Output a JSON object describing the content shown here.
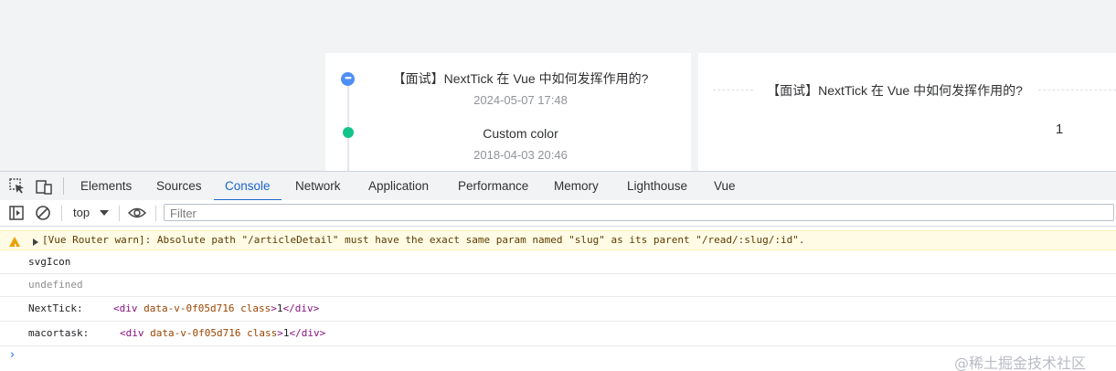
{
  "app": {
    "timeline": [
      {
        "title": "【面试】NextTick 在 Vue 中如何发挥作用的?",
        "timestamp": "2024-05-07 17:48",
        "dot_color": "#4e8ff5",
        "dot_icon": "more-icon"
      },
      {
        "title": "Custom color",
        "timestamp": "2018-04-03 20:46",
        "dot_color": "#13c38a"
      }
    ],
    "detail": {
      "title": "【面试】NextTick 在 Vue 中如何发挥作用的?",
      "value": "1"
    }
  },
  "devtools": {
    "tabs": [
      {
        "label": "Elements",
        "active": false
      },
      {
        "label": "Sources",
        "active": false
      },
      {
        "label": "Console",
        "active": true
      },
      {
        "label": "Network",
        "active": false
      },
      {
        "label": "Application",
        "active": false
      },
      {
        "label": "Performance",
        "active": false
      },
      {
        "label": "Memory",
        "active": false
      },
      {
        "label": "Lighthouse",
        "active": false
      },
      {
        "label": "Vue",
        "active": false
      }
    ],
    "toolbar": {
      "context": "top",
      "filter_placeholder": "Filter"
    },
    "console": {
      "warning": "[Vue Router warn]: Absolute path \"/articleDetail\" must have the exact same param named \"slug\" as its parent \"/read/:slug/:id\".",
      "log1": "svgIcon",
      "log2": "undefined",
      "log3_label": "NextTick:",
      "log4_label": "macortask:",
      "tag_open": "<div",
      "attr": "data-v-0f05d716 class",
      "tag_close_open": ">",
      "inner_text": "1",
      "tag_end": "</div>"
    },
    "colors": {
      "accent": "#1a64c8",
      "warning_bg": "#fffbe5"
    }
  },
  "watermark": "@稀土掘金技术社区"
}
